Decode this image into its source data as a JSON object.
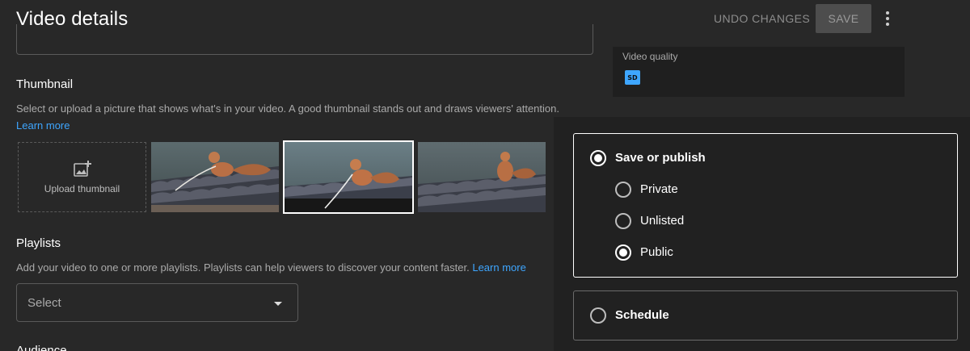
{
  "header": {
    "title": "Video details",
    "undo_label": "UNDO CHANGES",
    "save_label": "SAVE"
  },
  "video_quality": {
    "label": "Video quality",
    "badge": "SD",
    "badge_color": "#3ea6ff"
  },
  "thumbnail": {
    "title": "Thumbnail",
    "description": "Select or upload a picture that shows what's in your video. A good thumbnail stands out and draws viewers' attention.",
    "learn_more": "Learn more",
    "upload_label": "Upload thumbnail",
    "options": [
      {
        "selected": false
      },
      {
        "selected": true
      },
      {
        "selected": false
      }
    ]
  },
  "playlists": {
    "title": "Playlists",
    "description": "Add your video to one or more playlists. Playlists can help viewers to discover your content faster.",
    "learn_more": "Learn more",
    "select_value": "Select"
  },
  "audience": {
    "title": "Audience"
  },
  "visibility": {
    "save_or_publish": {
      "label": "Save or publish",
      "checked": true
    },
    "options": [
      {
        "label": "Private",
        "checked": false
      },
      {
        "label": "Unlisted",
        "checked": false
      },
      {
        "label": "Public",
        "checked": true
      }
    ],
    "schedule": {
      "label": "Schedule",
      "checked": false
    }
  },
  "colors": {
    "background": "#282828",
    "link": "#3ea6ff",
    "panel": "#212121"
  }
}
